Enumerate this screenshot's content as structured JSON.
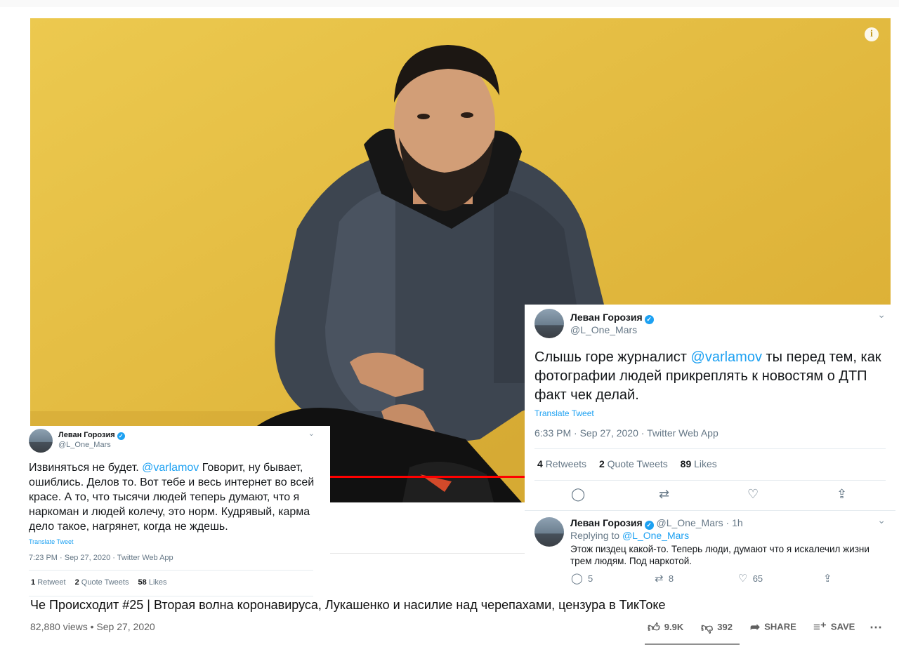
{
  "video": {
    "info_icon": "info-icon",
    "title": "Че Происходит #25 | Вторая волна коронавируса, Лукашенко и насилие над черепахами, цензура в ТикТоке",
    "views": "82,880 views",
    "date": "Sep 27, 2020",
    "likes": "9.9K",
    "dislikes": "392",
    "share_label": "SHARE",
    "save_label": "SAVE",
    "more_icon": "more-horizontal-icon"
  },
  "tweet_main": {
    "name": "Леван Горозия",
    "handle": "@L_One_Mars",
    "text_before": "Слышь горе журналист ",
    "mention": "@varlamov",
    "text_after": " ты перед тем, как фотографии людей прикреплять к новостям о ДТП факт чек делай.",
    "translate": "Translate Tweet",
    "meta": "6:33 PM · Sep 27, 2020 · Twitter Web App",
    "retweets": "4",
    "retweets_label": "Retweets",
    "quotes": "2",
    "quotes_label": "Quote Tweets",
    "likes": "89",
    "likes_label": "Likes"
  },
  "tweet_reply": {
    "name": "Леван Горозия",
    "handle_time": "@L_One_Mars · 1h",
    "replying_label": "Replying to",
    "replying_to": "@L_One_Mars",
    "text": "Этож пиздец какой-то. Теперь люди, думают что я искалечил жизни трем людям. Под наркотой.",
    "replies": "5",
    "retweets": "8",
    "likes": "65"
  },
  "tweet_left": {
    "name": "Леван Горозия",
    "handle": "@L_One_Mars",
    "text_before": "Извиняться не будет. ",
    "mention": "@varlamov",
    "text_after": " Говорит, ну бывает, ошиблись. Делов то. Вот тебе и весь интернет во всей красе. А то, что тысячи людей теперь думают, что я наркоман и людей колечу, это норм. Кудрявый, карма дело такое, нагрянет, когда не ждешь.",
    "translate": "Translate Tweet",
    "meta": "7:23 PM · Sep 27, 2020 · Twitter Web App",
    "retweets": "1",
    "retweets_label": "Retweet",
    "quotes": "2",
    "quotes_label": "Quote Tweets",
    "likes": "58",
    "likes_label": "Likes"
  },
  "icons": {
    "verified": "verified-badge-icon",
    "chevron": "chevron-down-icon",
    "reply": "reply-icon",
    "retweet": "retweet-icon",
    "like": "heart-icon",
    "share": "share-icon"
  }
}
